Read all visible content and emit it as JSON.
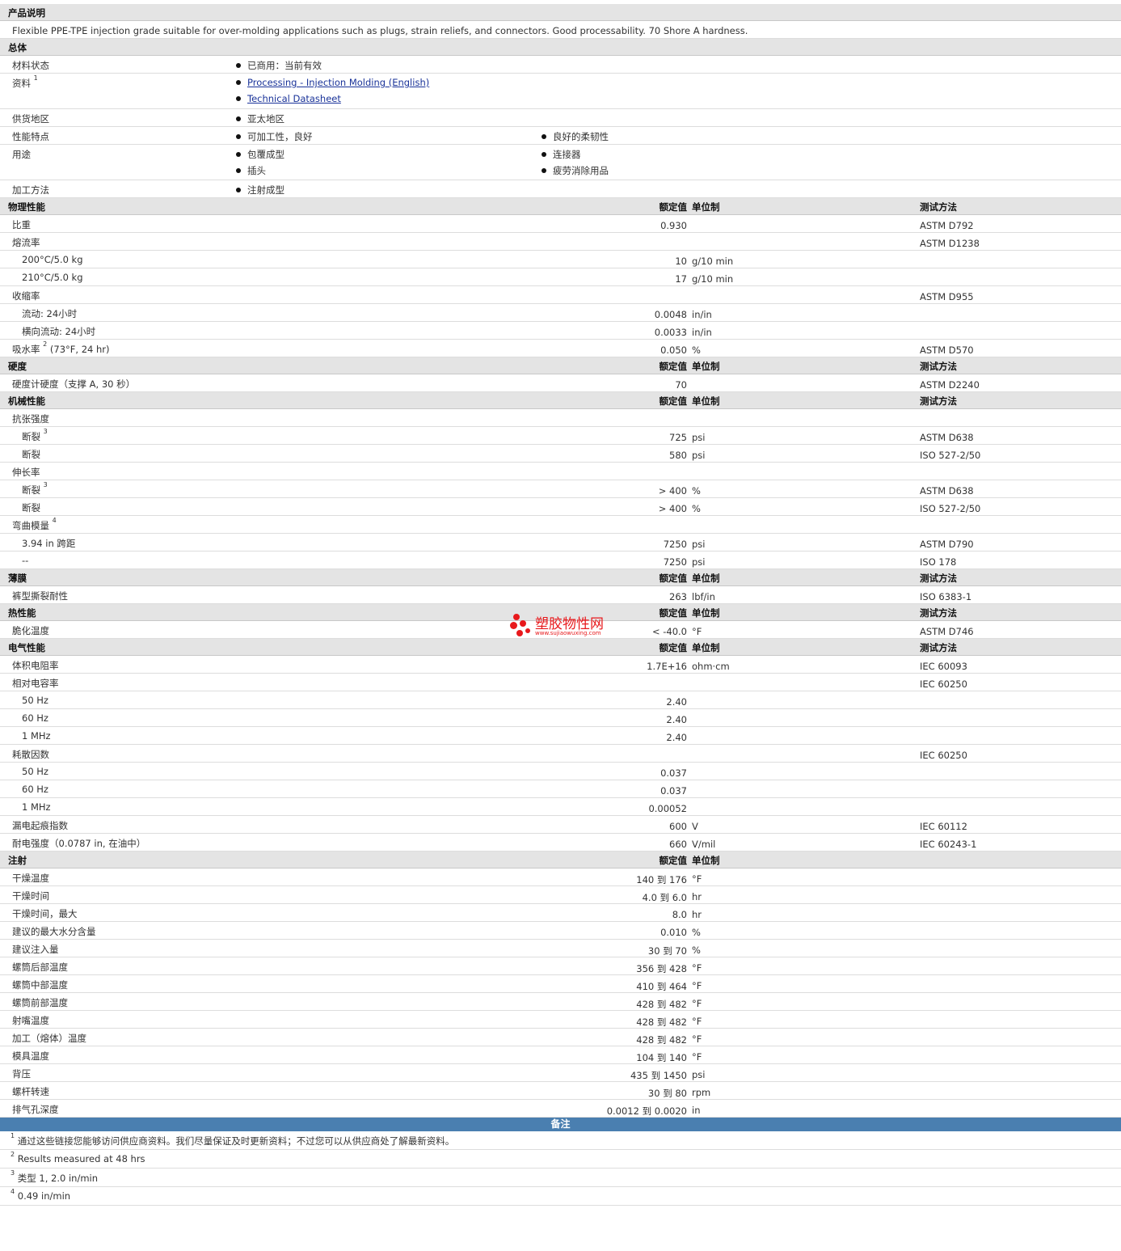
{
  "desc_header": "产品说明",
  "description": "Flexible PPE-TPE injection grade suitable for over-molding applications such as plugs, strain reliefs, and connectors. Good processability. 70 Shore A hardness.",
  "general": {
    "title": "总体",
    "status_label": "材料状态",
    "status_value": "已商用：当前有效",
    "docs_label": "资料",
    "docs_sup": "1",
    "docs": [
      "Processing - Injection Molding (English)",
      "Technical Datasheet"
    ],
    "region_label": "供货地区",
    "region_value": "亚太地区",
    "features_label": "性能特点",
    "features": [
      "可加工性，良好",
      "良好的柔韧性"
    ],
    "uses_label": "用途",
    "uses": [
      "包覆成型",
      "连接器",
      "插头",
      "疲劳消除用品"
    ],
    "method_label": "加工方法",
    "method_value": "注射成型"
  },
  "headers": {
    "nominal": "额定值",
    "unit": "单位制",
    "test": "测试方法"
  },
  "physical": {
    "title": "物理性能",
    "rows": [
      {
        "label": "比重",
        "value": "0.930",
        "unit": "",
        "test": "ASTM D792"
      },
      {
        "label": "熔流率",
        "value": "",
        "unit": "",
        "test": "ASTM D1238"
      },
      {
        "label": "200°C/5.0 kg",
        "value": "10",
        "unit": "g/10 min",
        "test": ""
      },
      {
        "label": "210°C/5.0 kg",
        "value": "17",
        "unit": "g/10 min",
        "test": ""
      },
      {
        "label": "收缩率",
        "value": "",
        "unit": "",
        "test": "ASTM D955"
      },
      {
        "label": "流动: 24小时",
        "value": "0.0048",
        "unit": "in/in",
        "test": ""
      },
      {
        "label": "横向流动: 24小时",
        "value": "0.0033",
        "unit": "in/in",
        "test": ""
      },
      {
        "label": "吸水率",
        "sup": "2",
        "suffix": " (73°F, 24 hr)",
        "value": "0.050",
        "unit": "%",
        "test": "ASTM D570"
      }
    ]
  },
  "hardness": {
    "title": "硬度",
    "rows": [
      {
        "label": "硬度计硬度（支撑 A, 30 秒）",
        "value": "70",
        "unit": "",
        "test": "ASTM D2240"
      }
    ]
  },
  "mechanical": {
    "title": "机械性能",
    "rows": [
      {
        "label": "抗张强度",
        "value": "",
        "unit": "",
        "test": ""
      },
      {
        "label": "断裂",
        "sup": "3",
        "value": "725",
        "unit": "psi",
        "test": "ASTM D638"
      },
      {
        "label": "断裂",
        "value": "580",
        "unit": "psi",
        "test": "ISO 527-2/50"
      },
      {
        "label": "伸长率",
        "value": "",
        "unit": "",
        "test": ""
      },
      {
        "label": "断裂",
        "sup": "3",
        "value": "> 400",
        "unit": "%",
        "test": "ASTM D638"
      },
      {
        "label": "断裂",
        "value": "> 400",
        "unit": "%",
        "test": "ISO 527-2/50"
      },
      {
        "label": "弯曲模量",
        "sup": "4",
        "value": "",
        "unit": "",
        "test": ""
      },
      {
        "label": "3.94 in 跨距",
        "value": "7250",
        "unit": "psi",
        "test": "ASTM D790"
      },
      {
        "label": "--",
        "value": "7250",
        "unit": "psi",
        "test": "ISO 178"
      }
    ]
  },
  "film": {
    "title": "薄膜",
    "rows": [
      {
        "label": "裤型撕裂耐性",
        "value": "263",
        "unit": "lbf/in",
        "test": "ISO 6383-1"
      }
    ]
  },
  "thermal": {
    "title": "热性能",
    "rows": [
      {
        "label": "脆化温度",
        "value": "< -40.0",
        "unit": "°F",
        "test": "ASTM D746"
      }
    ]
  },
  "electrical": {
    "title": "电气性能",
    "rows": [
      {
        "label": "体积电阻率",
        "value": "1.7E+16",
        "unit": "ohm·cm",
        "test": "IEC 60093"
      },
      {
        "label": "相对电容率",
        "value": "",
        "unit": "",
        "test": "IEC 60250"
      },
      {
        "label": "50 Hz",
        "value": "2.40",
        "unit": "",
        "test": ""
      },
      {
        "label": "60 Hz",
        "value": "2.40",
        "unit": "",
        "test": ""
      },
      {
        "label": "1 MHz",
        "value": "2.40",
        "unit": "",
        "test": ""
      },
      {
        "label": "耗散因数",
        "value": "",
        "unit": "",
        "test": "IEC 60250"
      },
      {
        "label": "50 Hz",
        "value": "0.037",
        "unit": "",
        "test": ""
      },
      {
        "label": "60 Hz",
        "value": "0.037",
        "unit": "",
        "test": ""
      },
      {
        "label": "1 MHz",
        "value": "0.00052",
        "unit": "",
        "test": ""
      },
      {
        "label": "漏电起痕指数",
        "value": "600",
        "unit": "V",
        "test": "IEC 60112"
      },
      {
        "label": "耐电强度（0.0787 in, 在油中）",
        "value": "660",
        "unit": "V/mil",
        "test": "IEC 60243-1"
      }
    ]
  },
  "injection": {
    "title": "注射",
    "rows": [
      {
        "label": "干燥温度",
        "value": "140 到  176",
        "unit": "°F"
      },
      {
        "label": "干燥时间",
        "value": "4.0 到  6.0",
        "unit": "hr"
      },
      {
        "label": "干燥时间，最大",
        "value": "8.0",
        "unit": "hr"
      },
      {
        "label": "建议的最大水分含量",
        "value": "0.010",
        "unit": "%"
      },
      {
        "label": "建议注入量",
        "value": "30 到  70",
        "unit": "%"
      },
      {
        "label": "螺筒后部温度",
        "value": "356 到  428",
        "unit": "°F"
      },
      {
        "label": "螺筒中部温度",
        "value": "410 到  464",
        "unit": "°F"
      },
      {
        "label": "螺筒前部温度",
        "value": "428 到  482",
        "unit": "°F"
      },
      {
        "label": "射嘴温度",
        "value": "428 到  482",
        "unit": "°F"
      },
      {
        "label": "加工（熔体）温度",
        "value": "428 到  482",
        "unit": "°F"
      },
      {
        "label": "模具温度",
        "value": "104 到  140",
        "unit": "°F"
      },
      {
        "label": "背压",
        "value": "435 到  1450",
        "unit": "psi"
      },
      {
        "label": "螺杆转速",
        "value": "30 到  80",
        "unit": "rpm"
      },
      {
        "label": "排气孔深度",
        "value": "0.0012 到  0.0020",
        "unit": "in"
      }
    ]
  },
  "notes": {
    "title": "备注",
    "items": [
      {
        "num": "1",
        "text": "通过这些链接您能够访问供应商资料。我们尽量保证及时更新资料；不过您可以从供应商处了解最新资料。"
      },
      {
        "num": "2",
        "text": "Results measured at 48 hrs"
      },
      {
        "num": "3",
        "text": "类型  1, 2.0 in/min"
      },
      {
        "num": "4",
        "text": "0.49 in/min"
      }
    ]
  },
  "watermark": {
    "name": "塑胶物性网",
    "url": "www.sujiaowuxing.com",
    "color": "#e8191c"
  },
  "colors": {
    "section_bg": "#e4e4e4",
    "notes_bar": "#4a7fb0",
    "link": "#1a3399"
  }
}
